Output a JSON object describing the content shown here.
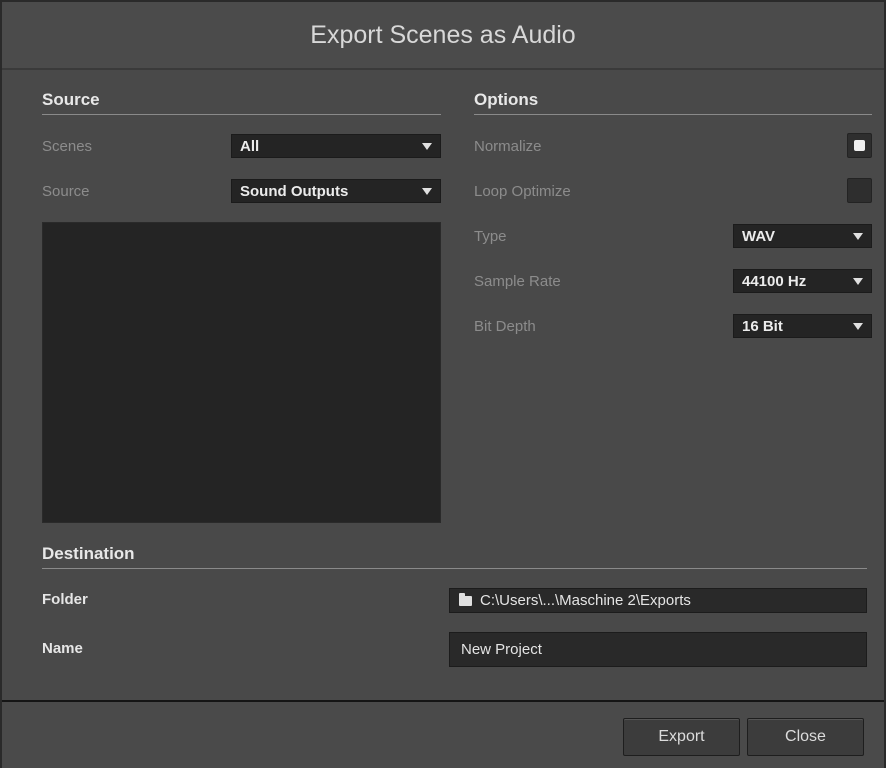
{
  "dialog": {
    "title": "Export Scenes as Audio"
  },
  "source": {
    "heading": "Source",
    "scenes_label": "Scenes",
    "scenes_value": "All",
    "source_label": "Source",
    "source_value": "Sound Outputs"
  },
  "options": {
    "heading": "Options",
    "normalize_label": "Normalize",
    "normalize_checked": true,
    "loop_optimize_label": "Loop Optimize",
    "loop_optimize_checked": false,
    "type_label": "Type",
    "type_value": "WAV",
    "sample_rate_label": "Sample Rate",
    "sample_rate_value": "44100 Hz",
    "bit_depth_label": "Bit Depth",
    "bit_depth_value": "16 Bit"
  },
  "destination": {
    "heading": "Destination",
    "folder_label": "Folder",
    "folder_value": "C:\\Users\\...\\Maschine 2\\Exports",
    "folder_icon": "folder-icon",
    "name_label": "Name",
    "name_value": "New Project"
  },
  "buttons": {
    "export": "Export",
    "close": "Close"
  }
}
